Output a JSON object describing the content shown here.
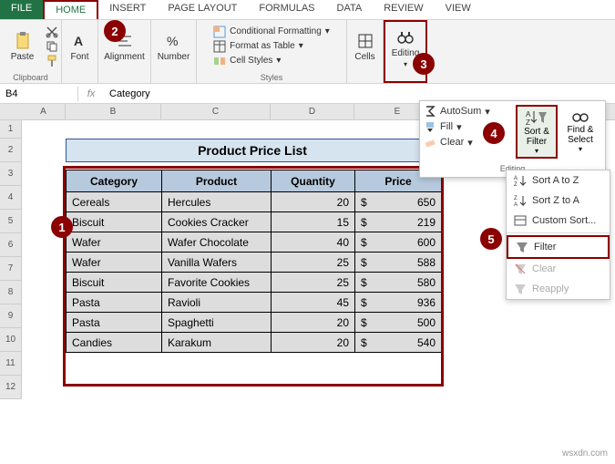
{
  "tabs": {
    "file": "FILE",
    "home": "HOME",
    "insert": "INSERT",
    "pagelayout": "PAGE LAYOUT",
    "formulas": "FORMULAS",
    "data": "DATA",
    "review": "REVIEW",
    "view": "VIEW"
  },
  "ribbon": {
    "clipboard": {
      "label": "Clipboard",
      "paste": "Paste"
    },
    "font": {
      "label": "Font",
      "btn": "Font"
    },
    "alignment": {
      "label": "Alignment",
      "btn": "Alignment"
    },
    "number": {
      "label": "Number",
      "btn": "Number"
    },
    "styles": {
      "label": "Styles",
      "cf": "Conditional Formatting",
      "fat": "Format as Table",
      "cs": "Cell Styles"
    },
    "cells": {
      "label": "Cells",
      "btn": "Cells"
    },
    "editing": {
      "label": "Editing",
      "btn": "Editing"
    }
  },
  "namebox": "B4",
  "fx": "fx",
  "formula": "Category",
  "cols": [
    "A",
    "B",
    "C",
    "D",
    "E"
  ],
  "rows": [
    "1",
    "2",
    "3",
    "4",
    "5",
    "6",
    "7",
    "8",
    "9",
    "10",
    "11",
    "12"
  ],
  "title": "Product Price List",
  "headers": {
    "cat": "Category",
    "prod": "Product",
    "qty": "Quantity",
    "price": "Price"
  },
  "data": [
    {
      "cat": "Cereals",
      "prod": "Hercules",
      "qty": "20",
      "cur": "$",
      "price": "650"
    },
    {
      "cat": "Biscuit",
      "prod": "Cookies Cracker",
      "qty": "15",
      "cur": "$",
      "price": "219"
    },
    {
      "cat": "Wafer",
      "prod": "Wafer Chocolate",
      "qty": "40",
      "cur": "$",
      "price": "600"
    },
    {
      "cat": "Wafer",
      "prod": "Vanilla Wafers",
      "qty": "25",
      "cur": "$",
      "price": "588"
    },
    {
      "cat": "Biscuit",
      "prod": "Favorite Cookies",
      "qty": "25",
      "cur": "$",
      "price": "580"
    },
    {
      "cat": "Pasta",
      "prod": "Ravioli",
      "qty": "45",
      "cur": "$",
      "price": "936"
    },
    {
      "cat": "Pasta",
      "prod": "Spaghetti",
      "qty": "20",
      "cur": "$",
      "price": "500"
    },
    {
      "cat": "Candies",
      "prod": "Karakum",
      "qty": "20",
      "cur": "$",
      "price": "540"
    }
  ],
  "editpanel": {
    "autosum": "AutoSum",
    "fill": "Fill",
    "clear": "Clear",
    "sortfilter": "Sort & Filter",
    "findselect": "Find & Select",
    "footer": "Editing"
  },
  "sortmenu": {
    "az": "Sort A to Z",
    "za": "Sort Z to A",
    "custom": "Custom Sort...",
    "filter": "Filter",
    "clear": "Clear",
    "reapply": "Reapply"
  },
  "callouts": {
    "c1": "1",
    "c2": "2",
    "c3": "3",
    "c4": "4",
    "c5": "5"
  },
  "colwidths": {
    "A": 48,
    "B": 105,
    "C": 120,
    "D": 92,
    "E": 95
  },
  "watermark": "wsxdn.com"
}
